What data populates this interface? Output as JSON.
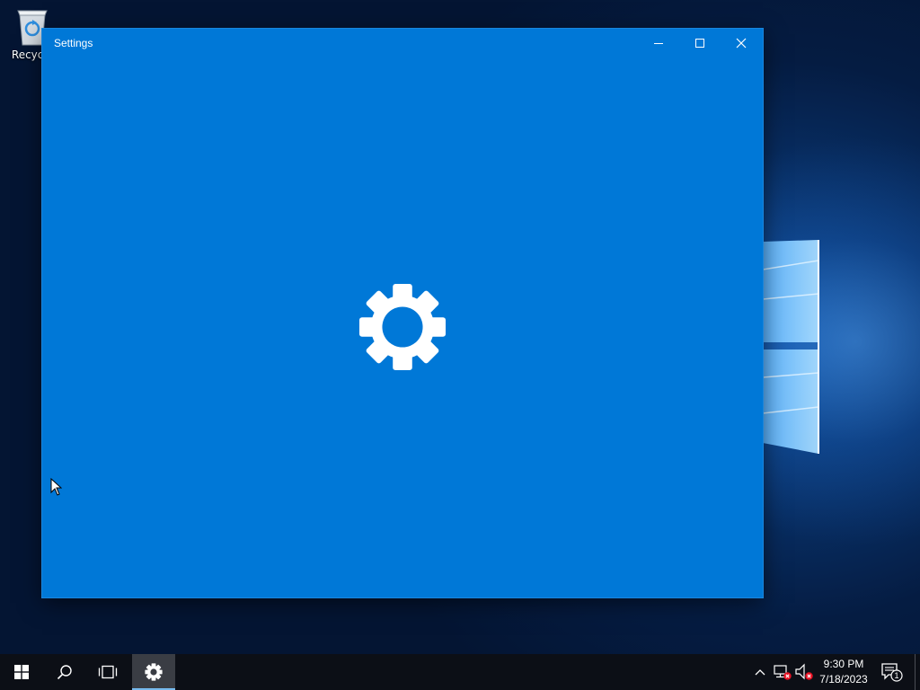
{
  "desktop": {
    "recycle_bin_label": "Recycle",
    "icons": {
      "recycle_bin": "recycle-bin-icon",
      "windows_logo": "windows-logo"
    }
  },
  "window": {
    "title": "Settings",
    "accent_color": "#0078d7",
    "controls": {
      "minimize": "minimize-icon",
      "maximize": "maximize-icon",
      "close": "close-icon"
    },
    "splash_icon": "gear-icon"
  },
  "taskbar": {
    "background_color": "#0c0f16",
    "items": [
      "start-icon",
      "search-icon",
      "task-view-icon",
      "settings-gear-icon"
    ],
    "tray": {
      "chevron": "chevron-up-icon",
      "network": "network-disconnected-icon",
      "volume": "volume-muted-icon",
      "notifications": "action-center-icon",
      "notification_count": "1"
    },
    "clock": {
      "time": "9:30 PM",
      "date": "7/18/2023"
    }
  }
}
